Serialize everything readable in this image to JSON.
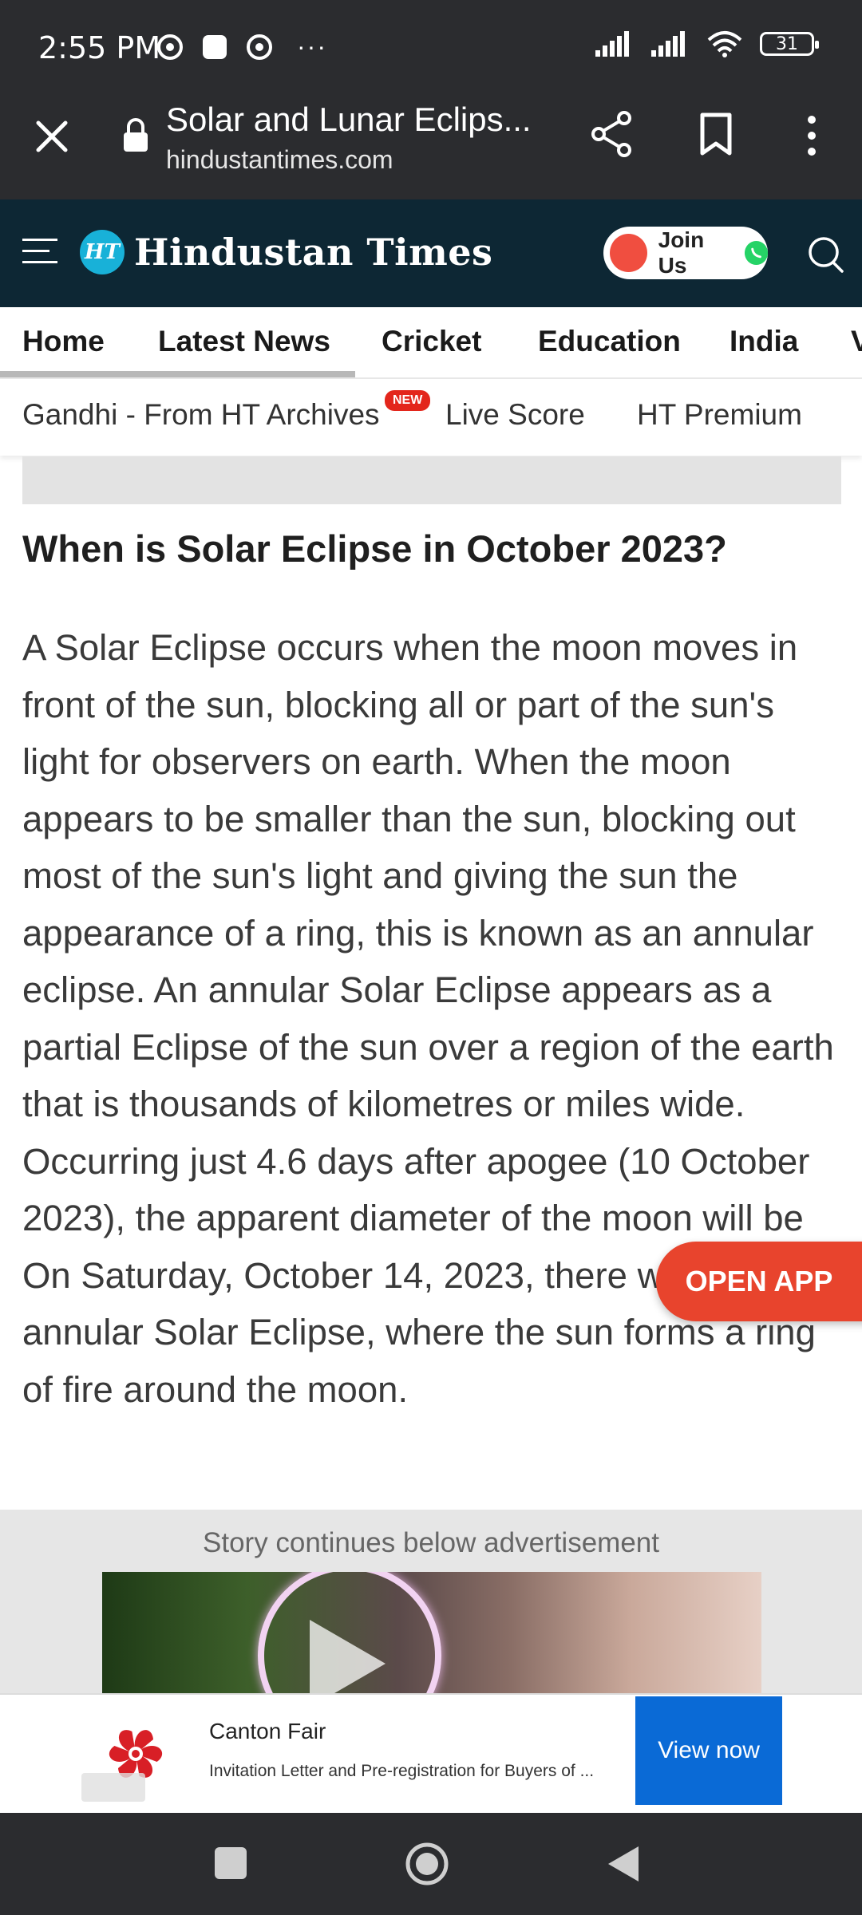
{
  "status_bar": {
    "time": "2:55 PM",
    "more": "···",
    "battery": "31"
  },
  "browser": {
    "title": "Solar and Lunar Eclips...",
    "url": "hindustantimes.com"
  },
  "site": {
    "logo_mark": "HT",
    "logo_text": "Hindustan Times",
    "join_label": "Join Us"
  },
  "nav": {
    "tabs": [
      "Home",
      "Latest News",
      "Cricket",
      "Education",
      "India",
      "V"
    ]
  },
  "sub_nav": {
    "items": [
      "Gandhi - From HT Archives",
      "Live Score",
      "HT Premium"
    ],
    "badge": "NEW"
  },
  "article": {
    "heading": "When is Solar Eclipse in October 2023?",
    "body": "A Solar Eclipse occurs when the moon moves in front of the sun, blocking all or part of the sun's light for observers on earth. When the moon appears to be smaller than the sun, blocking out most of the sun's light and giving the sun the appearance of a ring, this is known as an annular eclipse. An annular Solar Eclipse appears as a partial Eclipse of the sun over a region of the earth that is thousands of kilometres or miles wide. Occurring just 4.6 days after apogee (10 October 2023), the apparent diameter of the moon will be On Saturday, October 14, 2023, there will be an annular Solar Eclipse, where the sun forms a ring of fire around the moon."
  },
  "open_app_label": "OPEN APP",
  "ad": {
    "story_continues": "Story continues below advertisement",
    "advertiser": "Canton Fair",
    "description": "Invitation Letter and Pre-registration for Buyers of ...",
    "cta": "View now"
  },
  "colors": {
    "header_bg": "#0d2734",
    "chrome_bg": "#2b2c2f",
    "open_app": "#e8442d",
    "cta_blue": "#0a6ad6"
  }
}
